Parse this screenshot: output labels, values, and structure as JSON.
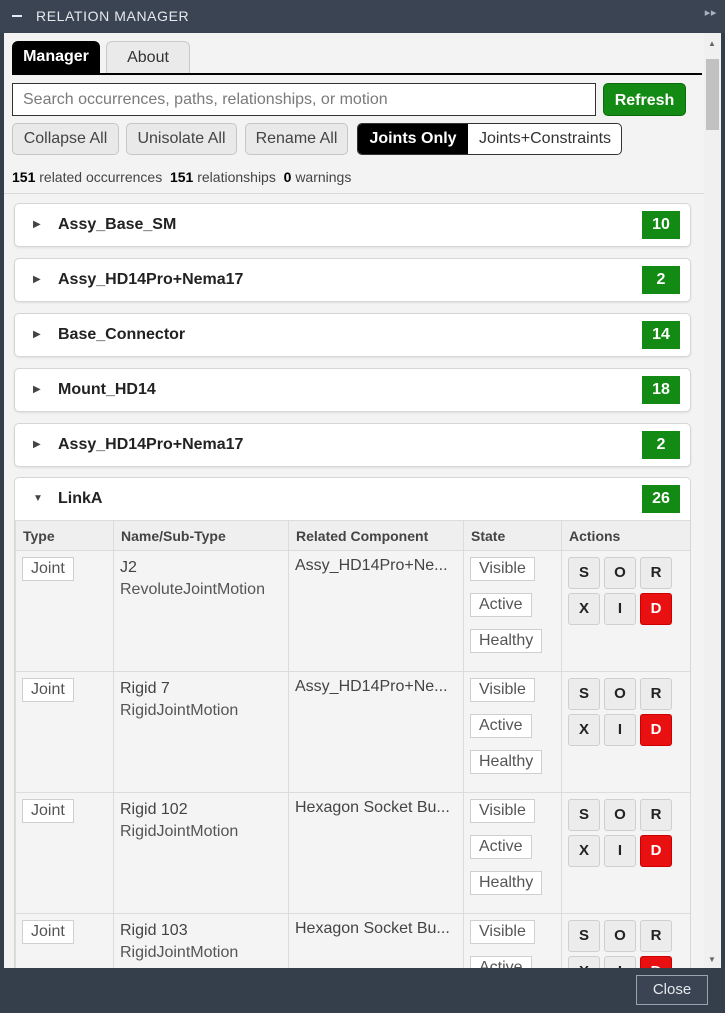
{
  "window": {
    "title": "RELATION MANAGER",
    "close_label": "Close"
  },
  "tabs": [
    {
      "label": "Manager"
    },
    {
      "label": "About"
    }
  ],
  "search": {
    "placeholder": "Search occurrences, paths, relationships, or motion",
    "value": ""
  },
  "toolbar": {
    "refresh_label": "Refresh",
    "collapse_label": "Collapse All",
    "unisolate_label": "Unisolate All",
    "rename_label": "Rename All",
    "filter_options": [
      "Joints Only",
      "Joints+Constraints"
    ],
    "filter_selected": "Joints Only"
  },
  "stats": {
    "occurrences_count": "151",
    "occurrences_label": "related occurrences",
    "relationships_count": "151",
    "relationships_label": "relationships",
    "warnings_count": "0",
    "warnings_label": "warnings"
  },
  "groups": [
    {
      "name": "Assy_Base_SM",
      "count": "10",
      "expanded": false
    },
    {
      "name": "Assy_HD14Pro+Nema17",
      "count": "2",
      "expanded": false
    },
    {
      "name": "Base_Connector",
      "count": "14",
      "expanded": false
    },
    {
      "name": "Mount_HD14",
      "count": "18",
      "expanded": false
    },
    {
      "name": "Assy_HD14Pro+Nema17",
      "count": "2",
      "expanded": false
    },
    {
      "name": "LinkA",
      "count": "26",
      "expanded": true
    }
  ],
  "table": {
    "headers": [
      "Type",
      "Name/Sub-Type",
      "Related Component",
      "State",
      "Actions"
    ],
    "rows": [
      {
        "type": "Joint",
        "name": "J2",
        "subtype": "RevoluteJointMotion",
        "component": "Assy_HD14Pro+Ne...",
        "states": [
          "Visible",
          "Active",
          "Healthy"
        ]
      },
      {
        "type": "Joint",
        "name": "Rigid 7",
        "subtype": "RigidJointMotion",
        "component": "Assy_HD14Pro+Ne...",
        "states": [
          "Visible",
          "Active",
          "Healthy"
        ]
      },
      {
        "type": "Joint",
        "name": "Rigid 102",
        "subtype": "RigidJointMotion",
        "component": "Hexagon Socket Bu...",
        "states": [
          "Visible",
          "Active",
          "Healthy"
        ]
      },
      {
        "type": "Joint",
        "name": "Rigid 103",
        "subtype": "RigidJointMotion",
        "component": "Hexagon Socket Bu...",
        "states": [
          "Visible",
          "Active"
        ]
      }
    ],
    "actions": [
      "S",
      "O",
      "R",
      "X",
      "I",
      "D"
    ]
  },
  "colors": {
    "accent_green": "#138a13",
    "danger_red": "#e81010",
    "titlebar": "#3a4452"
  }
}
